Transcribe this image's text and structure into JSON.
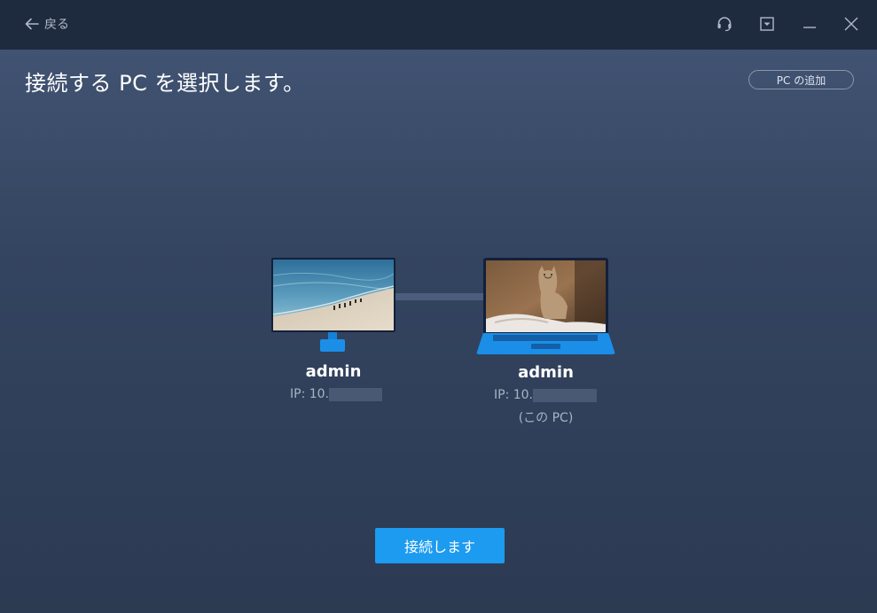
{
  "titlebar": {
    "back_label": "戻る",
    "icons": {
      "back": "arrow-left-icon",
      "support": "headset-icon",
      "menu": "dropdown-menu-icon",
      "minimize": "minimize-icon",
      "close": "close-icon"
    }
  },
  "page": {
    "title": "接続する PC を選択します。",
    "add_pc_label": "PC の追加"
  },
  "devices": [
    {
      "type": "desktop-monitor",
      "name": "admin",
      "ip_label": "IP: 10."
    },
    {
      "type": "laptop",
      "name": "admin",
      "ip_label": "IP: 10.",
      "note": "(この PC)"
    }
  ],
  "actions": {
    "connect_label": "接続します"
  },
  "colors": {
    "titlebar_bg": "#1e2a3e",
    "main_bg_top": "#415372",
    "main_bg_bottom": "#2c3a52",
    "accent": "#1c9bf0",
    "device_blue": "#1b8fe8"
  }
}
